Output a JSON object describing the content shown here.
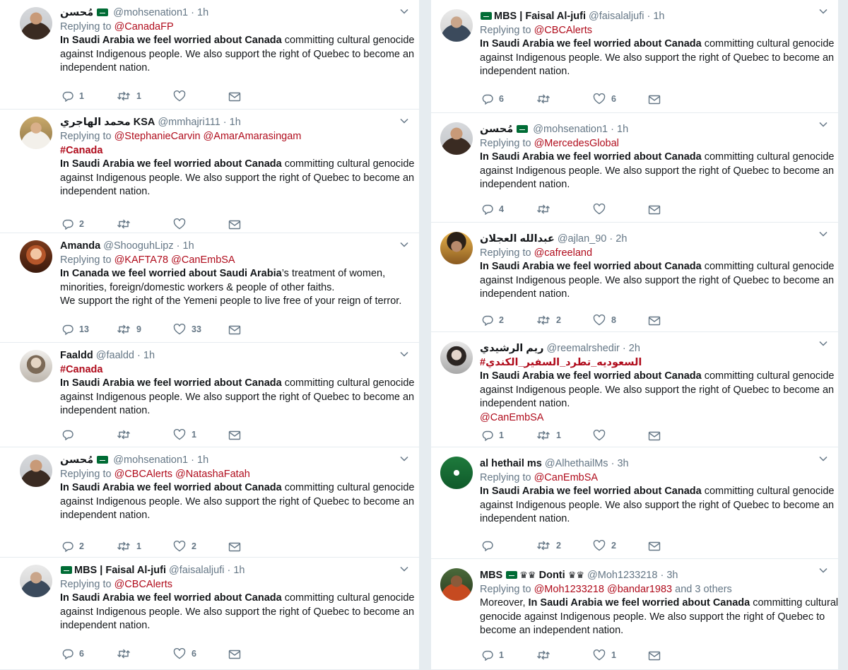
{
  "colors": {
    "link": "#b00c1c",
    "meta": "#657786",
    "text": "#14171a",
    "flag": "#006c35"
  },
  "icons": {
    "reply": "reply-icon",
    "retweet": "retweet-icon",
    "like": "heart-icon",
    "dm": "envelope-icon",
    "caret": "chevron-down-icon"
  },
  "left": [
    {
      "name": "مُحسن",
      "flag_before_name": false,
      "flag_after_name": true,
      "handle": "@mohsenation1",
      "time": "1h",
      "replying_label": "Replying to",
      "replying_to": [
        "@CanadaFP"
      ],
      "replying_extra": "",
      "hashtag": "",
      "body": [
        {
          "b": "In Saudi Arabia we feel worried about Canada",
          "t": " committing cultural genocide"
        },
        {
          "b": "",
          "t": "against Indigenous people. We also support the right of Quebec to become an"
        },
        {
          "b": "",
          "t": "independent nation."
        }
      ],
      "mention_after": "",
      "counts": {
        "reply": "1",
        "retweet": "1",
        "like": ""
      }
    },
    {
      "name": "محمد الهاجري KSA",
      "flag_before_name": false,
      "flag_after_name": false,
      "handle": "@mmhajri111",
      "time": "1h",
      "replying_label": "Replying to",
      "replying_to": [
        "@StephanieCarvin",
        "@AmarAmarasingam"
      ],
      "replying_extra": "",
      "hashtag": "#Canada",
      "body": [
        {
          "b": "In Saudi Arabia we feel worried about Canada",
          "t": " committing cultural genocide"
        },
        {
          "b": "",
          "t": "against Indigenous people. We also support the right of Quebec to become an"
        },
        {
          "b": "",
          "t": "independent nation."
        }
      ],
      "mention_after": "",
      "counts": {
        "reply": "2",
        "retweet": "",
        "like": ""
      }
    },
    {
      "name": "Amanda",
      "flag_before_name": false,
      "flag_after_name": false,
      "handle": "@ShooguhLipz",
      "time": "1h",
      "replying_label": "Replying to",
      "replying_to": [
        "@KAFTA78",
        "@CanEmbSA"
      ],
      "replying_extra": "",
      "hashtag": "",
      "body": [
        {
          "b": "In Canada we feel worried about Saudi Arabia",
          "t": "’s treatment of women,"
        },
        {
          "b": "",
          "t": "minorities, foreign/domestic workers & people of other faiths."
        },
        {
          "b": "",
          "t": "We support the right of the Yemeni people to live free of your reign of terror."
        }
      ],
      "mention_after": "",
      "counts": {
        "reply": "13",
        "retweet": "9",
        "like": "33"
      }
    },
    {
      "name": "Faaldd",
      "flag_before_name": false,
      "flag_after_name": false,
      "handle": "@faaldd",
      "time": "1h",
      "replying_label": "",
      "replying_to": [],
      "replying_extra": "",
      "hashtag": "#Canada",
      "body": [
        {
          "b": "In Saudi Arabia we feel worried about Canada",
          "t": " committing cultural genocide"
        },
        {
          "b": "",
          "t": "against Indigenous people. We also support the right of Quebec to become an"
        },
        {
          "b": "",
          "t": "independent nation."
        }
      ],
      "mention_after": "",
      "counts": {
        "reply": "",
        "retweet": "",
        "like": "1"
      }
    },
    {
      "name": "مُحسن",
      "flag_before_name": false,
      "flag_after_name": true,
      "handle": "@mohsenation1",
      "time": "1h",
      "replying_label": "Replying to",
      "replying_to": [
        "@CBCAlerts",
        "@NatashaFatah"
      ],
      "replying_extra": "",
      "hashtag": "",
      "body": [
        {
          "b": "In Saudi Arabia we feel worried about Canada",
          "t": " committing cultural genocide"
        },
        {
          "b": "",
          "t": "against Indigenous people. We also support the right of Quebec to become an"
        },
        {
          "b": "",
          "t": "independent nation."
        }
      ],
      "mention_after": "",
      "counts": {
        "reply": "2",
        "retweet": "1",
        "like": "2"
      }
    },
    {
      "name": "MBS | Faisal Al-jufi",
      "flag_before_name": true,
      "flag_after_name": false,
      "handle": "@faisalaljufi",
      "time": "1h",
      "replying_label": "Replying to",
      "replying_to": [
        "@CBCAlerts"
      ],
      "replying_extra": "",
      "hashtag": "",
      "body": [
        {
          "b": "In Saudi Arabia we feel worried about Canada",
          "t": " committing cultural genocide"
        },
        {
          "b": "",
          "t": "against Indigenous people. We also support the right of Quebec to become an"
        },
        {
          "b": "",
          "t": "independent nation."
        }
      ],
      "mention_after": "",
      "counts": {
        "reply": "6",
        "retweet": "",
        "like": "6"
      }
    }
  ],
  "right": [
    {
      "name": "MBS | Faisal Al-jufi",
      "flag_before_name": true,
      "flag_after_name": false,
      "handle": "@faisalaljufi",
      "time": "1h",
      "replying_label": "Replying to",
      "replying_to": [
        "@CBCAlerts"
      ],
      "replying_extra": "",
      "hashtag": "",
      "body": [
        {
          "b": "In Saudi Arabia we feel worried about Canada",
          "t": " committing cultural genocide"
        },
        {
          "b": "",
          "t": "against Indigenous people. We also support the right of Quebec to become an"
        },
        {
          "b": "",
          "t": "independent nation."
        }
      ],
      "mention_after": "",
      "counts": {
        "reply": "6",
        "retweet": "",
        "like": "6"
      }
    },
    {
      "name": "مُحسن",
      "flag_before_name": false,
      "flag_after_name": true,
      "handle": "@mohsenation1",
      "time": "1h",
      "replying_label": "Replying to",
      "replying_to": [
        "@MercedesGlobal"
      ],
      "replying_extra": "",
      "hashtag": "",
      "body": [
        {
          "b": "In Saudi Arabia we feel worried about Canada",
          "t": " committing cultural genocide"
        },
        {
          "b": "",
          "t": "against Indigenous people. We also support the right of Quebec to become an"
        },
        {
          "b": "",
          "t": "independent nation."
        }
      ],
      "mention_after": "",
      "counts": {
        "reply": "4",
        "retweet": "",
        "like": ""
      }
    },
    {
      "name": "عبدالله العجلان",
      "flag_before_name": false,
      "flag_after_name": false,
      "handle": "@ajlan_90",
      "time": "2h",
      "replying_label": "Replying to",
      "replying_to": [
        "@cafreeland"
      ],
      "replying_extra": "",
      "hashtag": "",
      "body": [
        {
          "b": "In Saudi Arabia we feel worried about Canada",
          "t": " committing cultural genocide"
        },
        {
          "b": "",
          "t": "against Indigenous people. We also support the right of Quebec to become an"
        },
        {
          "b": "",
          "t": "independent nation."
        }
      ],
      "mention_after": "",
      "counts": {
        "reply": "2",
        "retweet": "2",
        "like": "8"
      }
    },
    {
      "name": "ريم الرشيدي",
      "flag_before_name": false,
      "flag_after_name": false,
      "handle": "@reemalrshedir",
      "time": "2h",
      "replying_label": "",
      "replying_to": [],
      "replying_extra": "",
      "hashtag": "#السعوديه_تطرد_السفير_الكندي",
      "body": [
        {
          "b": "In Saudi Arabia we feel worried about Canada",
          "t": " committing cultural genocide"
        },
        {
          "b": "",
          "t": "against Indigenous people. We also support the right of Quebec to become an"
        },
        {
          "b": "",
          "t": "independent nation."
        }
      ],
      "mention_after": "@CanEmbSA",
      "counts": {
        "reply": "1",
        "retweet": "1",
        "like": ""
      }
    },
    {
      "name": "al hethail ms",
      "flag_before_name": false,
      "flag_after_name": false,
      "handle": "@AlhethailMs",
      "time": "3h",
      "replying_label": "Replying to",
      "replying_to": [
        "@CanEmbSA"
      ],
      "replying_extra": "",
      "hashtag": "",
      "body": [
        {
          "b": "In Saudi Arabia we feel worried about Canada",
          "t": " committing cultural genocide"
        },
        {
          "b": "",
          "t": "against Indigenous people. We also support the right of Quebec to become an"
        },
        {
          "b": "",
          "t": "independent nation."
        }
      ],
      "mention_after": "",
      "counts": {
        "reply": "",
        "retweet": "2",
        "like": "2"
      }
    },
    {
      "name": "MBS",
      "name2": "Donti",
      "crowns": true,
      "flag_before_name": false,
      "flag_after_name": false,
      "handle": "@Moh1233218",
      "time": "3h",
      "replying_label": "Replying to",
      "replying_to": [
        "@Moh1233218",
        "@bandar1983"
      ],
      "replying_extra": "and 3 others",
      "hashtag": "",
      "body": [
        {
          "pre": "Moreover, ",
          "b": "In Saudi Arabia we feel worried about Canada",
          "t": " committing cultural"
        },
        {
          "b": "",
          "t": "genocide against Indigenous people. We also support the right of Quebec to"
        },
        {
          "b": "",
          "t": "become an independent nation."
        }
      ],
      "mention_after": "",
      "counts": {
        "reply": "1",
        "retweet": "",
        "like": "1"
      }
    }
  ]
}
